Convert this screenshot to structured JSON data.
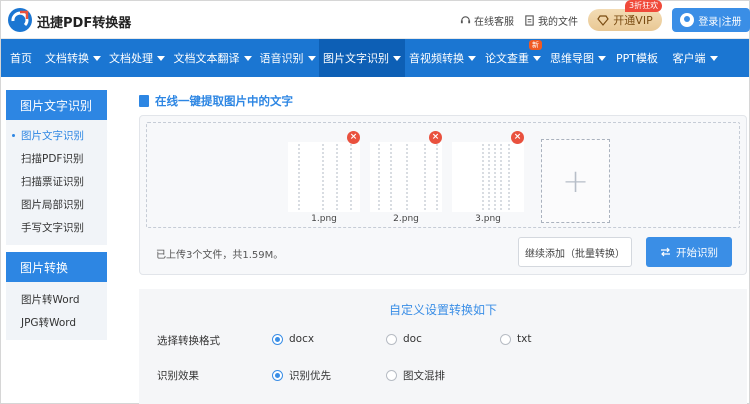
{
  "header": {
    "brand": "迅捷PDF转换器",
    "service_label": "在线客服",
    "files_label": "我的文件",
    "vip_label": "开通VIP",
    "vip_badge": "3折狂欢",
    "login_label": "登录|注册"
  },
  "nav": {
    "items": [
      {
        "label": "首页",
        "dropdown": false
      },
      {
        "label": "文档转换",
        "dropdown": true
      },
      {
        "label": "文档处理",
        "dropdown": true
      },
      {
        "label": "文档文本翻译",
        "dropdown": true
      },
      {
        "label": "语音识别",
        "dropdown": true
      },
      {
        "label": "图片文字识别",
        "dropdown": true,
        "active": true
      },
      {
        "label": "音视频转换",
        "dropdown": true
      },
      {
        "label": "论文查重",
        "dropdown": true,
        "badge": "新"
      },
      {
        "label": "思维导图",
        "dropdown": true
      },
      {
        "label": "PPT模板",
        "dropdown": false
      },
      {
        "label": "客户端",
        "dropdown": true
      }
    ]
  },
  "sidebar": {
    "section1_title": "图片文字识别",
    "section1_items": [
      "图片文字识别",
      "扫描PDF识别",
      "扫描票证识别",
      "图片局部识别",
      "手写文字识别"
    ],
    "section2_title": "图片转换",
    "section2_items": [
      "图片转Word",
      "JPG转Word"
    ]
  },
  "main": {
    "title": "在线一键提取图片中的文字",
    "files": [
      "1.png",
      "2.png",
      "3.png"
    ],
    "delete_symbol": "×",
    "add_symbol": "+",
    "upload_info": "已上传3个文件，共1.59M。",
    "continue_label": "继续添加（批量转换）",
    "start_label": "开始识别"
  },
  "settings": {
    "title": "自定义设置转换如下",
    "format_label": "选择转换格式",
    "format_options": [
      "docx",
      "doc",
      "txt"
    ],
    "format_selected": "docx",
    "effect_label": "识别效果",
    "effect_options": [
      "识别优先",
      "图文混排"
    ],
    "effect_selected": "识别优先"
  },
  "colors": {
    "nav_bg": "#1b76d2",
    "accent": "#2d86e3",
    "delete_red": "#e9513e"
  }
}
